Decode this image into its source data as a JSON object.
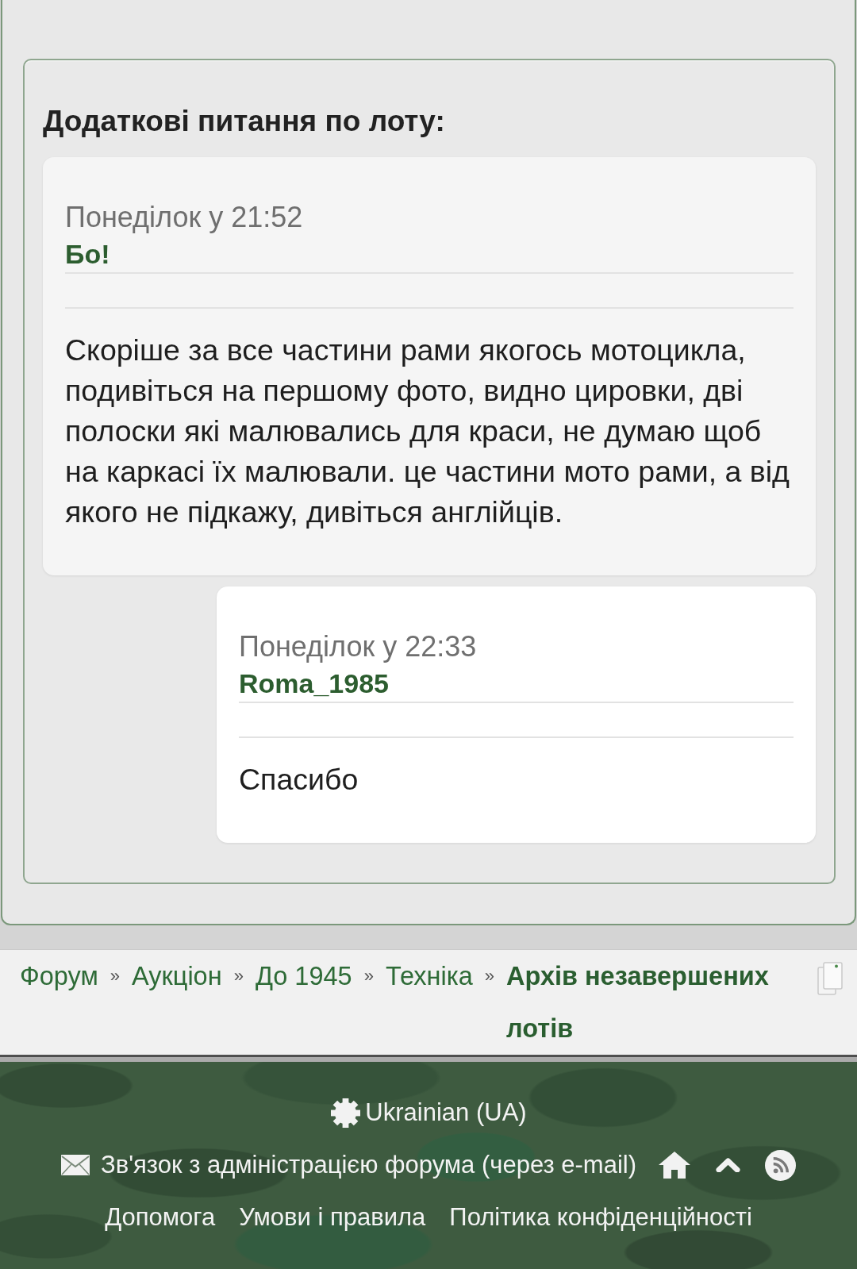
{
  "section": {
    "title": "Додаткові питання по лоту:"
  },
  "comments": [
    {
      "kind": "question",
      "time": "Понеділок у 21:52",
      "author": "Бо!",
      "text": "Скоріше за все частини рами якогось мотоцикла, подивіться на першому фото, видно цировки, дві полоски які малювались для краси, не думаю щоб на каркасі їх малювали. це частини мото рами, а від якого не підкажу, дивіться англійців."
    },
    {
      "kind": "reply",
      "time": "Понеділок у 22:33",
      "author": "Roma_1985",
      "text": "Спасибо"
    }
  ],
  "breadcrumb": [
    {
      "label": "Форум",
      "current": false,
      "separator": "»"
    },
    {
      "label": "Аукціон",
      "current": false,
      "separator": "»"
    },
    {
      "label": "До 1945",
      "current": false,
      "separator": "»"
    },
    {
      "label": "Техніка",
      "current": false,
      "separator": "»"
    },
    {
      "label": "Архів незавершених лотів",
      "current": true
    }
  ],
  "footer": {
    "language": "Ukrainian (UA)",
    "contact": "Зв'язок з адміністрацією форума (через e-mail)",
    "links": [
      "Допомога",
      "Умови і правила",
      "Політика конфіденційності"
    ]
  }
}
